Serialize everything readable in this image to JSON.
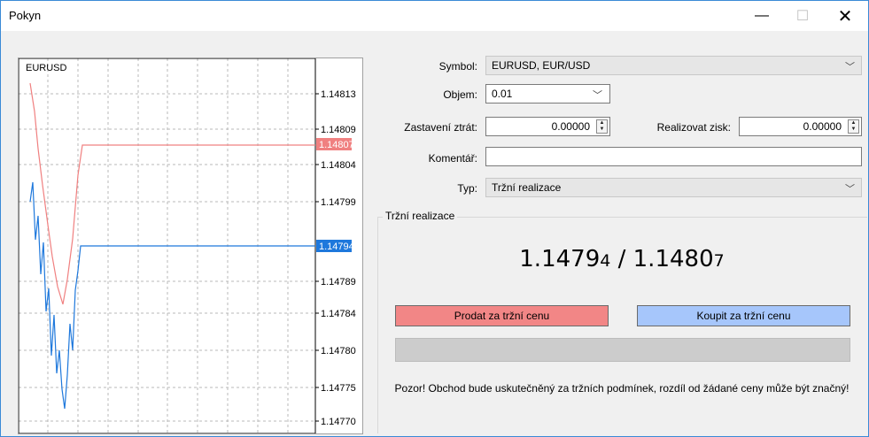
{
  "window": {
    "title": "Pokyn",
    "minimize": "—",
    "maximize": "☐",
    "close": "✕"
  },
  "chart": {
    "symbol": "EURUSD",
    "price_labels": [
      "1.14813",
      "1.14809",
      "1.14804",
      "1.14799",
      "1.14789",
      "1.14784",
      "1.14780",
      "1.14775",
      "1.14770"
    ],
    "ask_label": "1.14807",
    "bid_label": "1.14794",
    "ask_color": "#f08080",
    "bid_color": "#1e78dc"
  },
  "form": {
    "symbol_label": "Symbol:",
    "symbol_value": "EURUSD, EUR/USD",
    "volume_label": "Objem:",
    "volume_value": "0.01",
    "sl_label": "Zastavení ztrát:",
    "sl_value": "0.00000",
    "tp_label": "Realizovat zisk:",
    "tp_value": "0.00000",
    "comment_label": "Komentář:",
    "comment_value": "",
    "type_label": "Typ:",
    "type_value": "Tržní realizace"
  },
  "execution": {
    "group_title": "Tržní realizace",
    "bid_main": "1.14794",
    "ask_main": "1.14807",
    "separator": " / ",
    "sell_label": "Prodat za tržní cenu",
    "buy_label": "Koupit za tržní cenu",
    "warning": "Pozor! Obchod bude uskutečněný za tržních podmínek, rozdíl od žádané ceny může být značný!"
  },
  "icons": {
    "dropdown": "chevron-down-icon",
    "spin": "spinner-icon"
  }
}
